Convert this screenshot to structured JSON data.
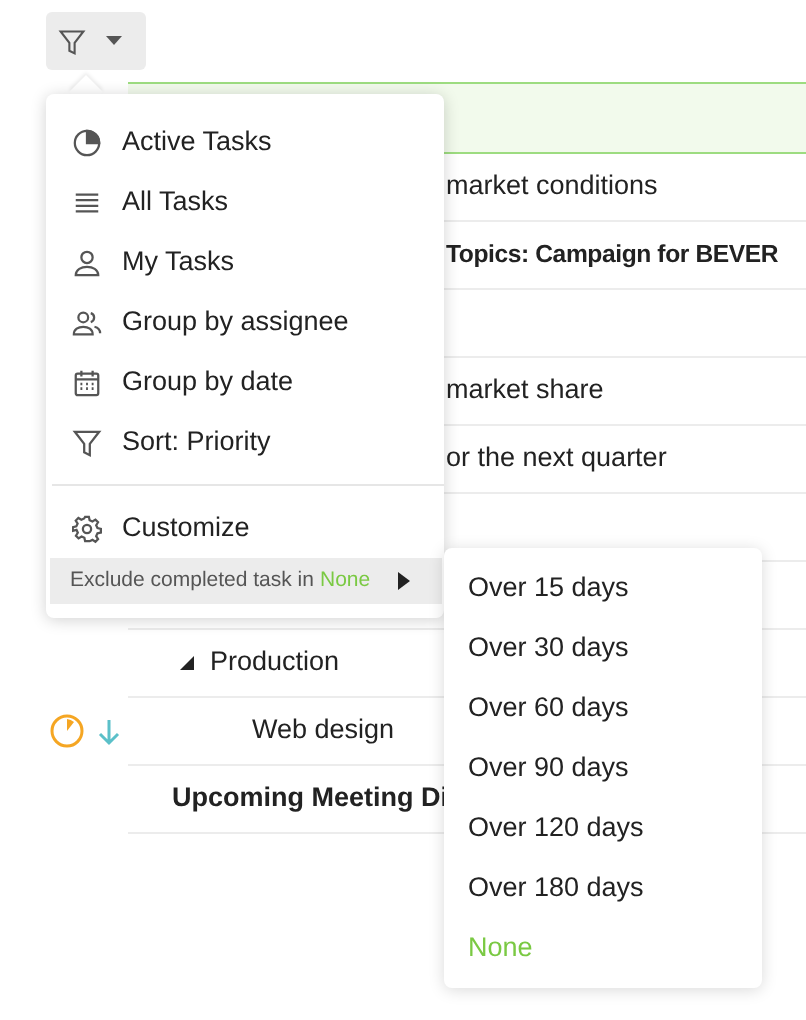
{
  "toolbar": {
    "filter_button": {
      "expanded": true
    }
  },
  "filter_menu": {
    "items": [
      {
        "label": "Active Tasks"
      },
      {
        "label": "All Tasks"
      },
      {
        "label": "My Tasks"
      },
      {
        "label": "Group by assignee"
      },
      {
        "label": "Group by date"
      },
      {
        "label": "Sort: Priority"
      },
      {
        "label": "Customize"
      }
    ],
    "exclude": {
      "label": "Exclude completed task in",
      "value": "None"
    }
  },
  "exclude_submenu": {
    "options": [
      {
        "label": "Over 15 days",
        "selected": false
      },
      {
        "label": "Over 30 days",
        "selected": false
      },
      {
        "label": "Over 60 days",
        "selected": false
      },
      {
        "label": "Over 90 days",
        "selected": false
      },
      {
        "label": "Over 120 days",
        "selected": false
      },
      {
        "label": "Over 180 days",
        "selected": false
      },
      {
        "label": "None",
        "selected": true
      }
    ]
  },
  "task_list": {
    "rows": [
      {
        "kind": "band"
      },
      {
        "kind": "task",
        "text": "market conditions",
        "bold": false
      },
      {
        "kind": "task",
        "text": "Topics: Campaign for BEVER",
        "bold": true
      },
      {
        "kind": "blank"
      },
      {
        "kind": "task",
        "text": "market share",
        "bold": false
      },
      {
        "kind": "task",
        "text": "or the next quarter",
        "bold": false
      },
      {
        "kind": "blank"
      },
      {
        "kind": "blank"
      },
      {
        "kind": "group",
        "text": "Production",
        "expanded": true
      },
      {
        "kind": "subtask",
        "text": "Web design",
        "in_progress": true,
        "low_priority": true
      },
      {
        "kind": "heading",
        "text": "Upcoming Meeting Di"
      }
    ]
  }
}
